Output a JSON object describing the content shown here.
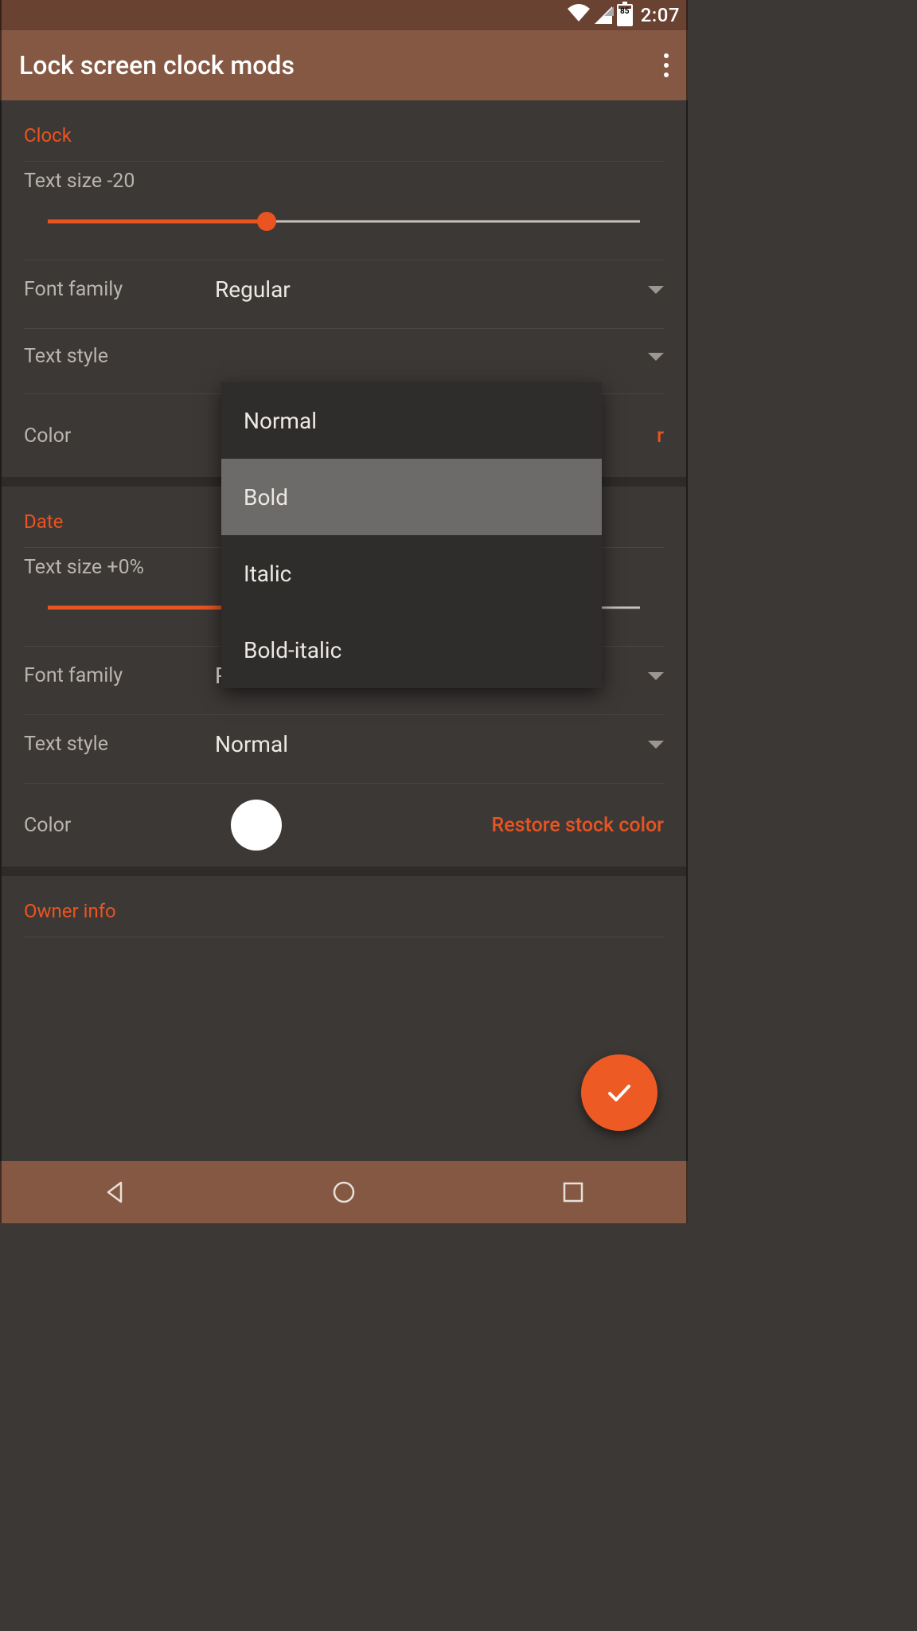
{
  "statusbar": {
    "battery": "85",
    "time": "2:07"
  },
  "appbar": {
    "title": "Lock screen clock mods"
  },
  "sections": {
    "clock": {
      "header": "Clock",
      "text_size_label": "Text size -20",
      "slider_pct": 37,
      "font_family_label": "Font family",
      "font_family_value": "Regular",
      "text_style_label": "Text style",
      "color_label": "Color",
      "restore_label": "Restore stock color"
    },
    "date": {
      "header": "Date",
      "text_size_label": "Text size +0%",
      "slider_pct": 48,
      "font_family_label": "Font family",
      "font_family_value": "Regular",
      "text_style_label": "Text style",
      "text_style_value": "Normal",
      "color_label": "Color",
      "restore_label": "Restore stock color"
    },
    "ownerinfo": {
      "header": "Owner info"
    }
  },
  "dropdown": {
    "options": {
      "o1": "Normal",
      "o2": "Bold",
      "o3": "Italic",
      "o4": "Bold-italic"
    }
  }
}
